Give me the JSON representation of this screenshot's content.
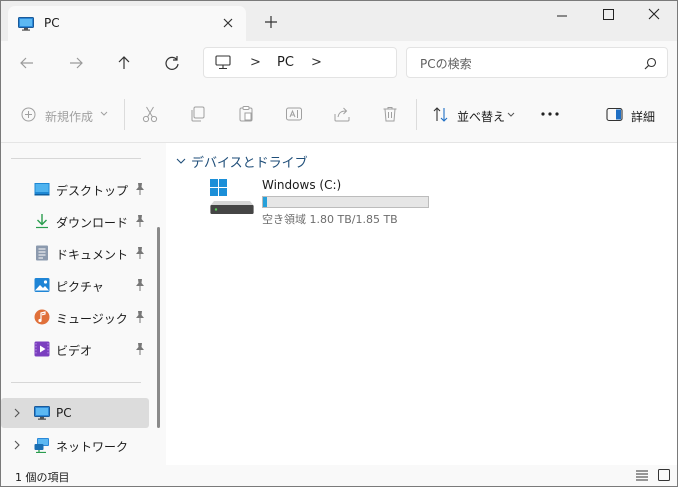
{
  "tab": {
    "title": "PC",
    "icon": "pc-icon",
    "close_icon": "close-icon",
    "new_tab_icon": "plus-icon"
  },
  "window_controls": {
    "minimize": "minimize-icon",
    "maximize": "maximize-icon",
    "close": "close-icon"
  },
  "nav": {
    "back_icon": "arrow-left-icon",
    "forward_icon": "arrow-right-icon",
    "up_icon": "arrow-up-icon",
    "refresh_icon": "refresh-icon",
    "address": {
      "icon": "pc-icon",
      "separator": ">",
      "segment": "PC"
    },
    "search": {
      "placeholder": "PCの検索",
      "icon": "search-icon"
    }
  },
  "commandbar": {
    "new_label": "新規作成",
    "sort_label": "並べ替え",
    "more_label": "•••",
    "details_label": "詳細",
    "icons": [
      "cut-icon",
      "copy-icon",
      "paste-icon",
      "rename-icon",
      "share-icon",
      "delete-icon"
    ]
  },
  "sidebar": {
    "quick_access": [
      {
        "label": "デスクトップ",
        "icon": "desktop-icon",
        "pinned": true
      },
      {
        "label": "ダウンロード",
        "icon": "download-icon",
        "pinned": true
      },
      {
        "label": "ドキュメント",
        "icon": "document-icon",
        "pinned": true
      },
      {
        "label": "ピクチャ",
        "icon": "pictures-icon",
        "pinned": true
      },
      {
        "label": "ミュージック",
        "icon": "music-icon",
        "pinned": true
      },
      {
        "label": "ビデオ",
        "icon": "video-icon",
        "pinned": true
      }
    ],
    "tree": [
      {
        "label": "PC",
        "icon": "pc-icon",
        "active": true
      },
      {
        "label": "ネットワーク",
        "icon": "network-icon",
        "active": false
      }
    ]
  },
  "content": {
    "group_title": "デバイスとドライブ",
    "drives": [
      {
        "name": "Windows (C:)",
        "free_text": "空き領域 1.80 TB/1.85 TB",
        "used_fraction": 0.027,
        "icon": "drive-icon"
      }
    ]
  },
  "status": {
    "item_count": "1 個の項目"
  },
  "colors": {
    "accent": "#26a0da",
    "group_title": "#1f4e79",
    "active_item": "#dcdcdc"
  }
}
